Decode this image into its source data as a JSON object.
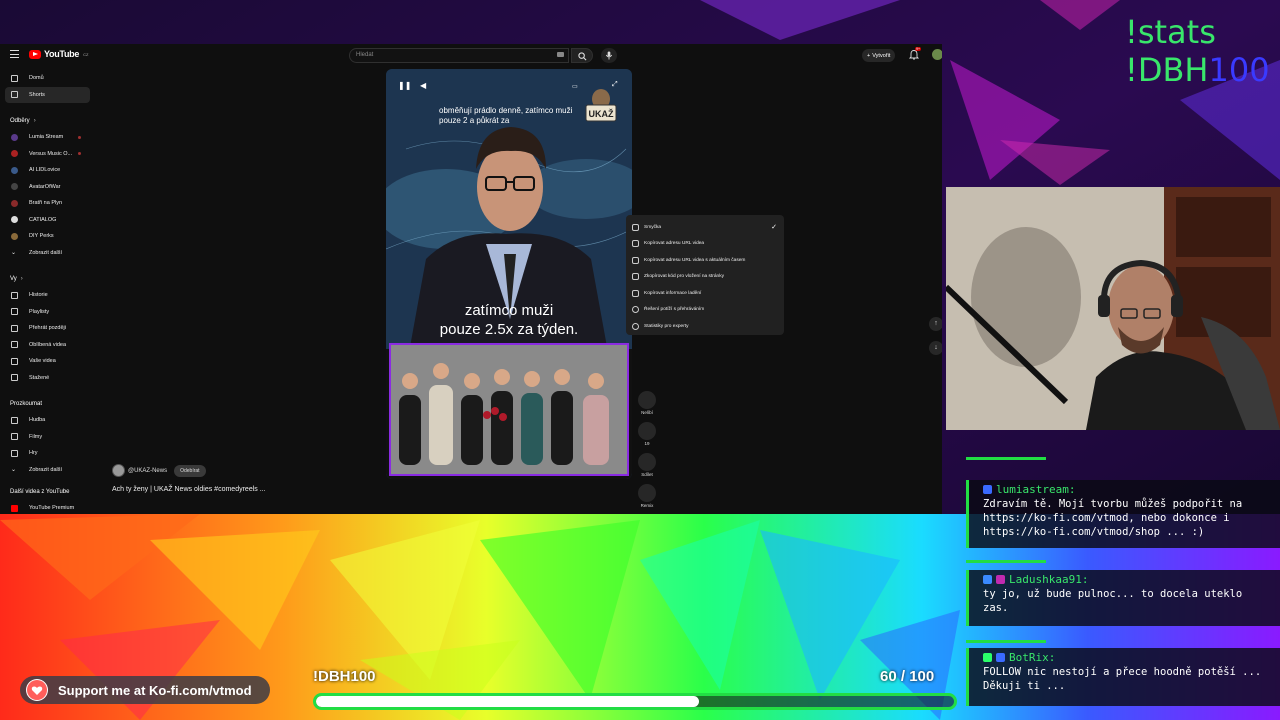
{
  "overlay": {
    "cmd_stats": "!stats",
    "cmd_dbh_prefix": "!DBH",
    "cmd_dbh_suffix": "100"
  },
  "youtube": {
    "logo_text": "YouTube",
    "logo_region": "CZ",
    "search_placeholder": "Hledat",
    "create_label": "Vytvořit",
    "notification_count": "9+",
    "sidebar": {
      "main": [
        {
          "label": "Domů",
          "icon": "home-icon"
        },
        {
          "label": "Shorts",
          "icon": "shorts-icon"
        }
      ],
      "subscriptions_heading": "Odběry",
      "subscriptions": [
        {
          "label": "Lumia Stream"
        },
        {
          "label": "Versus Music O..."
        },
        {
          "label": "AI LIDLovice"
        },
        {
          "label": "AvatarOfWar"
        },
        {
          "label": "Bratři na Plyn"
        },
        {
          "label": "CATIALOG"
        },
        {
          "label": "DIY Perks"
        }
      ],
      "subscriptions_more": "Zobrazit další",
      "you_heading": "Vy",
      "you": [
        {
          "label": "Historie",
          "icon": "history-icon"
        },
        {
          "label": "Playlisty",
          "icon": "playlist-icon"
        },
        {
          "label": "Přehrát později",
          "icon": "watch-later-icon"
        },
        {
          "label": "Oblíbená videa",
          "icon": "like-icon"
        },
        {
          "label": "Vaše videa",
          "icon": "your-videos-icon"
        },
        {
          "label": "Stažené",
          "icon": "download-icon"
        }
      ],
      "explore_heading": "Prozkoumat",
      "explore": [
        {
          "label": "Hudba",
          "icon": "music-icon"
        },
        {
          "label": "Filmy",
          "icon": "film-icon"
        },
        {
          "label": "Hry",
          "icon": "gamepad-icon"
        }
      ],
      "explore_more": "Zobrazit další",
      "more_heading": "Další videa z YouTube",
      "more": [
        {
          "label": "YouTube Premium"
        }
      ]
    },
    "short": {
      "caption_top": "obměňují prádlo denně, zatímco muži pouze 2 a půkrát za",
      "caption_big_line1": "zatímco muži",
      "caption_big_line2": "pouze 2.5x za týden.",
      "channel": "@UKAZ-News",
      "subscribe_label": "Odebírat",
      "title": "Ach ty ženy | UKAŽ News oldies #comedyreels ...",
      "logo_text": "UKAŽ"
    },
    "actions": [
      {
        "label": "Nelíbí",
        "icon": "dislike-icon"
      },
      {
        "label": "19",
        "icon": "comment-icon"
      },
      {
        "label": "Sdílet",
        "icon": "share-icon"
      },
      {
        "label": "Remix",
        "icon": "remix-icon"
      }
    ],
    "context_menu": [
      {
        "label": "Smyčka",
        "icon": "loop-icon",
        "checked": true
      },
      {
        "label": "Kopírovat adresu URL videa",
        "icon": "link-icon"
      },
      {
        "label": "Kopírovat adresu URL videa s aktuálním časem",
        "icon": "link-icon"
      },
      {
        "label": "Zkopírovat kód pro vložení na stránky",
        "icon": "embed-icon"
      },
      {
        "label": "Kopírovat informace ladění",
        "icon": "bug-icon"
      },
      {
        "label": "Řešení potíží s přehráváním",
        "icon": "help-icon"
      },
      {
        "label": "Statistiky pro experty",
        "icon": "info-icon"
      }
    ]
  },
  "chat": [
    {
      "user": "lumiastream:",
      "text": "Zdravím tě. Mojí tvorbu můžeš podpořit na https://ko-fi.com/vtmod, nebo dokonce i https://ko-fi.com/vtmod/shop ... :)"
    },
    {
      "user": "Ladushkaa91:",
      "text": "ty jo, už bude pulnoc... to docela uteklo zas."
    },
    {
      "user": "BotRix:",
      "text": "FOLLOW nic nestojí a přece hoodně potěší ... Děkuji ti ..."
    }
  ],
  "bottom": {
    "kofi_text": "Support me at Ko-fi.com/vtmod",
    "goal_name": "!DBH100",
    "goal_current": "60",
    "goal_separator": "/",
    "goal_target": "100",
    "goal_progress": 0.6
  },
  "colors": {
    "accent_green": "#39e66b",
    "chat_border": "#22dd44",
    "youtube_red": "#ff0000",
    "frame_purple": "#8a2be2"
  }
}
